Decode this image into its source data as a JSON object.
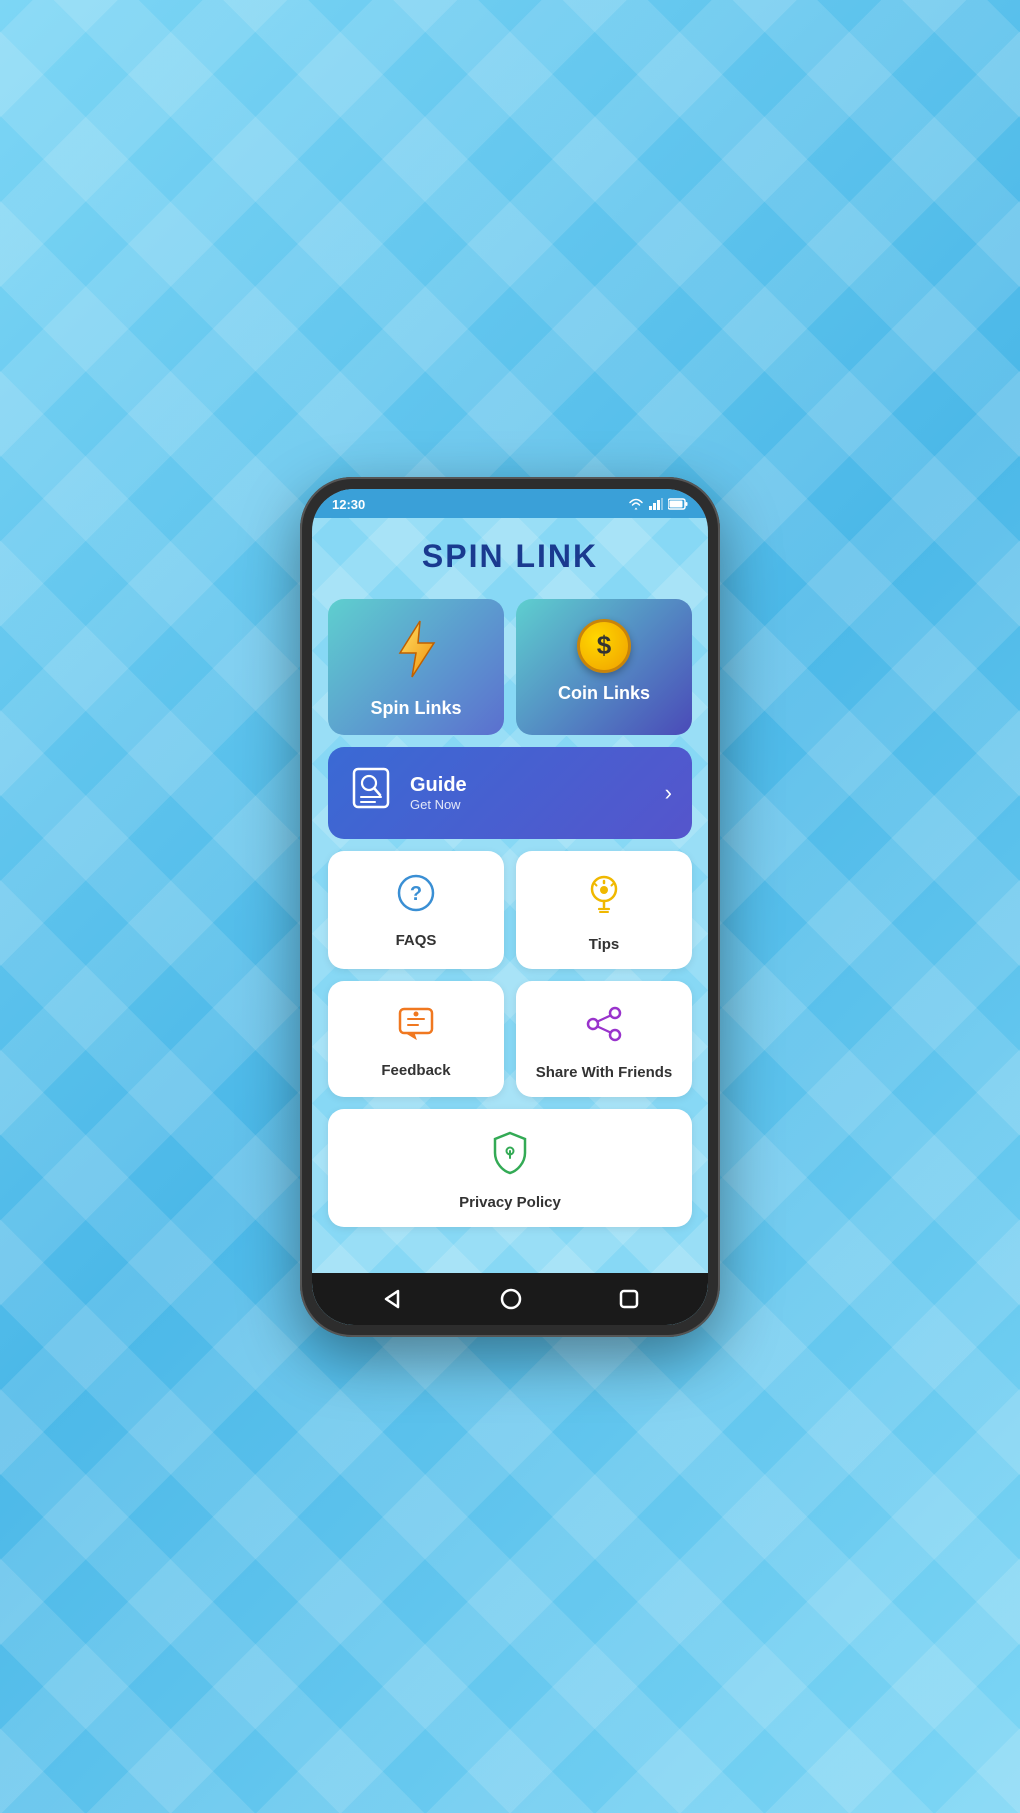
{
  "statusBar": {
    "time": "12:30"
  },
  "app": {
    "title": "SPIN LINK"
  },
  "cards": {
    "spinLinks": "Spin Links",
    "coinLinks": "Coin Links",
    "guide": {
      "title": "Guide",
      "subtitle": "Get Now"
    },
    "faqs": "FAQS",
    "tips": "Tips",
    "feedback": "Feedback",
    "shareWithFriends": "Share With Friends",
    "privacyPolicy": "Privacy Policy"
  },
  "bottomNav": {
    "back": "◁",
    "home": "○",
    "recent": "□"
  }
}
